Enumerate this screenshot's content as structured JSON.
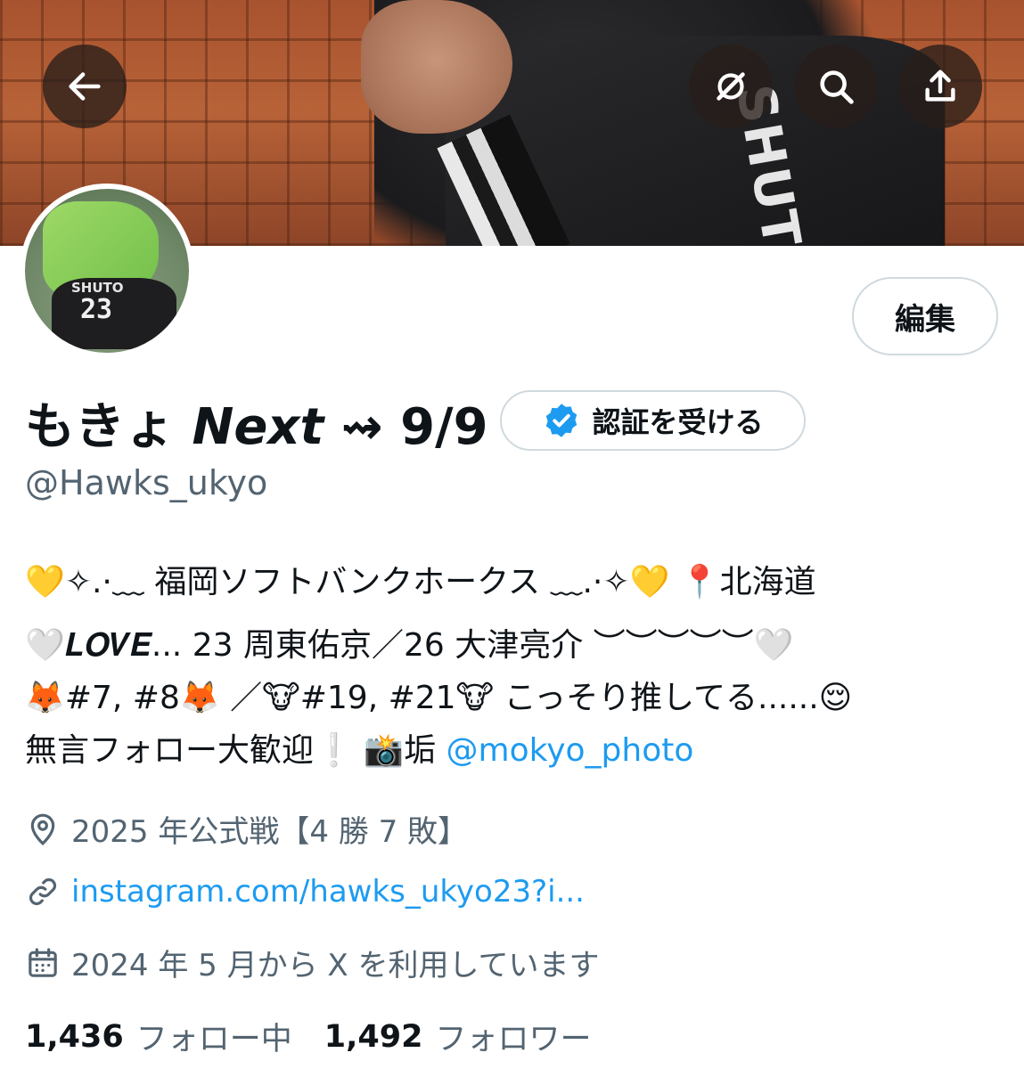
{
  "header": {
    "back_icon": "arrow-left-icon",
    "grok_icon": "grok-icon",
    "search_icon": "search-icon",
    "share_icon": "share-icon"
  },
  "banner": {
    "jersey_text": "SHUTO"
  },
  "avatar": {
    "jersey_name": "SHUTO",
    "jersey_number": "23"
  },
  "profile": {
    "edit_label": "編集",
    "display_name": "もきょ 𝙉𝙚𝙭𝙩 ⇝ 9/9",
    "verify_label": "認証を受ける",
    "handle": "@Hawks_ukyo"
  },
  "bio": {
    "line1": "💛✧.·﹏ 福岡ソフトバンクホークス ﹏.·✧💛 📍北海道",
    "line2": "🤍𝑳𝑶𝑽𝑬... 23 周東佑京／26 大津亮介 ︶︶︶︶︶🤍",
    "line3": "🦊#7, #8🦊 ／🐮#19, #21🐮 こっそり推してる......😌",
    "line4_text": "無言フォロー大歓迎❕ 📸垢 ",
    "line4_mention": "@mokyo_photo"
  },
  "meta": {
    "location_icon": "location-pin-icon",
    "location": "2025 年公式戦【4 勝 7 敗】",
    "link_icon": "link-icon",
    "link": "instagram.com/hawks_ukyo23?i...",
    "calendar_icon": "calendar-icon",
    "joined": "2024 年 5 月から X を利用しています"
  },
  "stats": {
    "following_count": "1,436",
    "following_label": "フォロー中",
    "followers_count": "1,492",
    "followers_label": "フォロワー"
  },
  "colors": {
    "accent": "#1d9bf0",
    "secondary_text": "#536471",
    "primary_text": "#0f1419",
    "border": "#cfd9de"
  }
}
